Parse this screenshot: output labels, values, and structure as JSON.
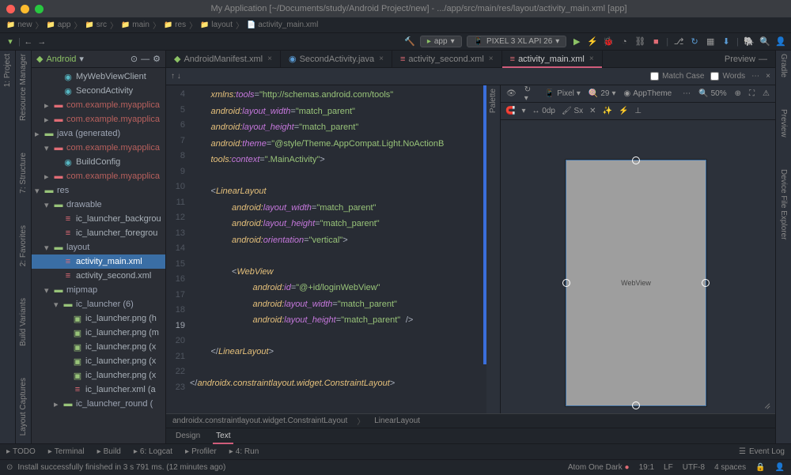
{
  "title": "My Application [~/Documents/study/Android Project/new] - .../app/src/main/res/layout/activity_main.xml [app]",
  "toolbar": {
    "run_config": "app",
    "device": "PIXEL 3 XL API 26"
  },
  "breadcrumb": [
    "new",
    "app",
    "src",
    "main",
    "res",
    "layout",
    "activity_main.xml"
  ],
  "project": {
    "view": "Android",
    "items": [
      {
        "label": "MyWebViewClient",
        "icon": "kotlin",
        "indent": 2
      },
      {
        "label": "SecondActivity",
        "icon": "kotlin",
        "indent": 2
      },
      {
        "label": "com.example.myapplica",
        "icon": "pkg-red",
        "indent": 1,
        "chevron": "▸"
      },
      {
        "label": "com.example.myapplica",
        "icon": "pkg-red",
        "indent": 1,
        "chevron": "▸"
      },
      {
        "label": "java (generated)",
        "icon": "folder",
        "indent": 0,
        "chevron": "▸"
      },
      {
        "label": "com.example.myapplica",
        "icon": "pkg-red",
        "indent": 1,
        "chevron": "▾"
      },
      {
        "label": "BuildConfig",
        "icon": "kotlin",
        "indent": 2
      },
      {
        "label": "com.example.myapplica",
        "icon": "pkg-red",
        "indent": 1,
        "chevron": "▸"
      },
      {
        "label": "res",
        "icon": "folder",
        "indent": 0,
        "chevron": "▾"
      },
      {
        "label": "drawable",
        "icon": "folder",
        "indent": 1,
        "chevron": "▾"
      },
      {
        "label": "ic_launcher_backgrou",
        "icon": "xml",
        "indent": 2
      },
      {
        "label": "ic_launcher_foregrou",
        "icon": "xml",
        "indent": 2
      },
      {
        "label": "layout",
        "icon": "folder",
        "indent": 1,
        "chevron": "▾"
      },
      {
        "label": "activity_main.xml",
        "icon": "xml",
        "indent": 2,
        "selected": true
      },
      {
        "label": "activity_second.xml",
        "icon": "xml",
        "indent": 2
      },
      {
        "label": "mipmap",
        "icon": "folder",
        "indent": 1,
        "chevron": "▾"
      },
      {
        "label": "ic_launcher (6)",
        "icon": "folder",
        "indent": 2,
        "chevron": "▾"
      },
      {
        "label": "ic_launcher.png (h",
        "icon": "img",
        "indent": 3
      },
      {
        "label": "ic_launcher.png (m",
        "icon": "img",
        "indent": 3
      },
      {
        "label": "ic_launcher.png (x",
        "icon": "img",
        "indent": 3
      },
      {
        "label": "ic_launcher.png (x",
        "icon": "img",
        "indent": 3
      },
      {
        "label": "ic_launcher.png (x",
        "icon": "img",
        "indent": 3
      },
      {
        "label": "ic_launcher.xml (a",
        "icon": "xml",
        "indent": 3
      },
      {
        "label": "ic_launcher_round (",
        "icon": "folder",
        "indent": 2,
        "chevron": "▸"
      }
    ]
  },
  "tabs": [
    {
      "label": "AndroidManifest.xml",
      "icon": "android"
    },
    {
      "label": "SecondActivity.java",
      "icon": "java"
    },
    {
      "label": "activity_second.xml",
      "icon": "xml"
    },
    {
      "label": "activity_main.xml",
      "icon": "xml",
      "active": true
    }
  ],
  "tab_preview": "Preview",
  "find": {
    "match_case": "Match Case",
    "words": "Words"
  },
  "lines_start": 4,
  "lines_end": 23,
  "active_line": 19,
  "editor_breadcrumb": [
    "androidx.constraintlayout.widget.ConstraintLayout",
    "LinearLayout"
  ],
  "editor_tabs": [
    "Design",
    "Text"
  ],
  "editor_active_tab": "Text",
  "preview_toolbar": {
    "mode": "Pixel",
    "api": "29",
    "theme": "AppTheme",
    "zoom": "50%"
  },
  "preview_toolbar2": {
    "scale": "0dp",
    "sx": "Sx"
  },
  "preview_label": "WebView",
  "palette_label": "Palette",
  "right_rails": [
    "Gradle",
    "Preview",
    "Device File Explorer"
  ],
  "left_rails": [
    "1: Project",
    "Resource Manager",
    "7: Structure",
    "2: Favorites",
    "Build Variants",
    "Layout Captures"
  ],
  "tools": [
    "TODO",
    "Terminal",
    "Build",
    "6: Logcat",
    "Profiler",
    "4: Run"
  ],
  "event_log": "Event Log",
  "status": {
    "msg": "Install successfully finished in 3 s 791 ms. (12 minutes ago)",
    "theme": "Atom One Dark",
    "pos": "19:1",
    "le": "LF",
    "enc": "UTF-8",
    "indent": "4 spaces"
  }
}
